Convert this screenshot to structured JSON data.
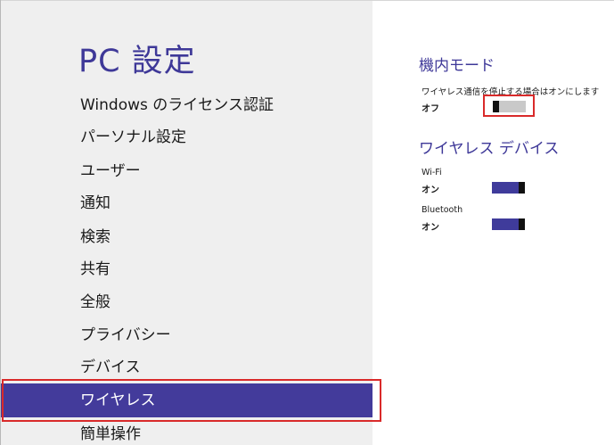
{
  "nav": {
    "title": "PC 設定",
    "items": [
      {
        "label": "Windows のライセンス認証"
      },
      {
        "label": "パーソナル設定"
      },
      {
        "label": "ユーザー"
      },
      {
        "label": "通知"
      },
      {
        "label": "検索"
      },
      {
        "label": "共有"
      },
      {
        "label": "全般"
      },
      {
        "label": "プライバシー"
      },
      {
        "label": "デバイス"
      },
      {
        "label": "ワイヤレス",
        "selected": true
      },
      {
        "label": "簡単操作"
      }
    ]
  },
  "airplane": {
    "title": "機内モード",
    "description": "ワイヤレス通信を停止する場合はオンにします",
    "state": "オフ",
    "is_on": false
  },
  "wireless_devices": {
    "title": "ワイヤレス デバイス",
    "devices": [
      {
        "name": "Wi-Fi",
        "state": "オン",
        "is_on": true
      },
      {
        "name": "Bluetooth",
        "state": "オン",
        "is_on": true
      }
    ]
  },
  "colors": {
    "accent": "#433b9b",
    "title": "#3e3898",
    "nav_bg": "#efefef",
    "highlight": "#d92a2a"
  }
}
